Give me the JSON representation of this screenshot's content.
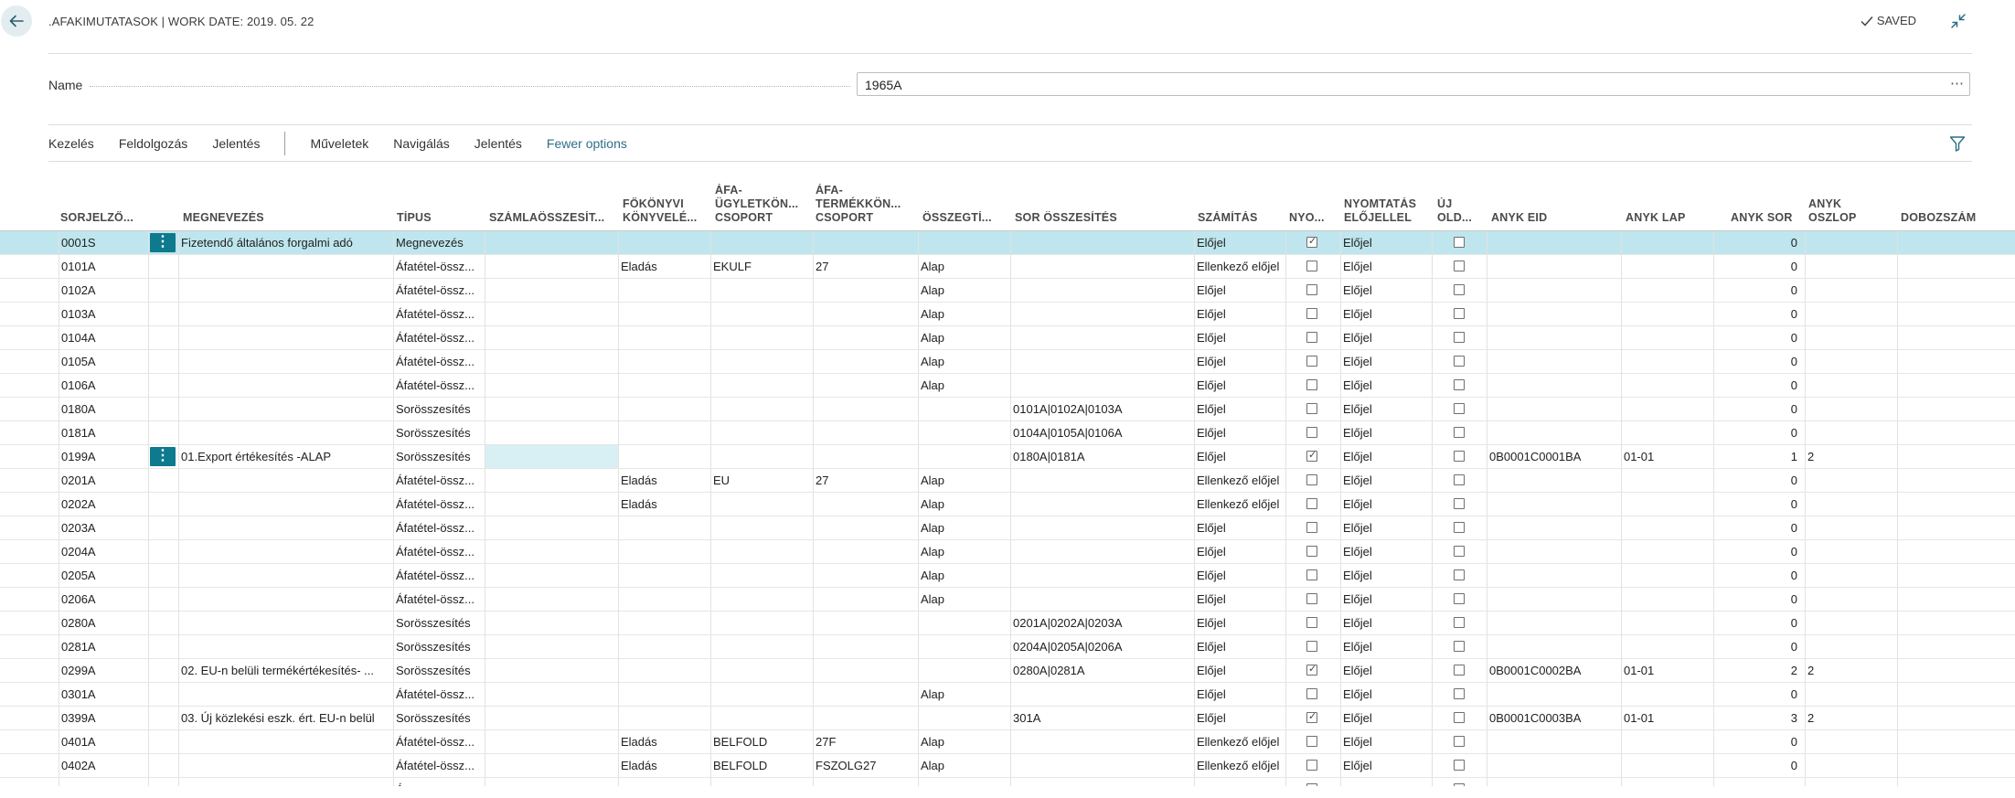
{
  "header": {
    "title": ".AFAKIMUTATASOK | WORK DATE: 2019. 05. 22",
    "saved_label": "SAVED"
  },
  "name_field": {
    "label": "Name",
    "value": "1965A"
  },
  "actions": {
    "items": [
      "Kezelés",
      "Feldolgozás",
      "Jelentés",
      "Műveletek",
      "Navigálás",
      "Jelentés"
    ],
    "fewer_options": "Fewer options"
  },
  "columns": [
    {
      "key": "sorjelzo",
      "l1": "",
      "l2": "SORJELZŐ..."
    },
    {
      "key": "megnevezes",
      "l1": "",
      "l2": "MEGNEVEZÉS"
    },
    {
      "key": "tipus",
      "l1": "",
      "l2": "TÍPUS"
    },
    {
      "key": "szamla",
      "l1": "",
      "l2": "SZÁMLAÖSSZESÍT..."
    },
    {
      "key": "fokonyv",
      "l1": "FŐKÖNYVI",
      "l2": "KÖNYVELÉ..."
    },
    {
      "key": "afa_ugylet",
      "l1": "ÁFA-",
      "l2": "ÜGYLETKÖN...",
      "l3": "CSOPORT"
    },
    {
      "key": "afa_termek",
      "l1": "ÁFA-",
      "l2": "TERMÉKKÖN...",
      "l3": "CSOPORT"
    },
    {
      "key": "osszegtip",
      "l1": "",
      "l2": "ÖSSZEGTÍ..."
    },
    {
      "key": "sor_ossz",
      "l1": "",
      "l2": "SOR ÖSSZESÍTÉS"
    },
    {
      "key": "szamitas",
      "l1": "",
      "l2": "SZÁMÍTÁS"
    },
    {
      "key": "nyo",
      "l1": "",
      "l2": "NYO..."
    },
    {
      "key": "nyomtatas",
      "l1": "NYOMTATÁS",
      "l2": "ELŐJELLEL"
    },
    {
      "key": "uj_old",
      "l1": "ÚJ",
      "l2": "OLD..."
    },
    {
      "key": "anyk_eid",
      "l1": "",
      "l2": "ANYK EID"
    },
    {
      "key": "anyk_lap",
      "l1": "",
      "l2": "ANYK LAP"
    },
    {
      "key": "anyk_sor",
      "l1": "",
      "l2": "ANYK SOR"
    },
    {
      "key": "anyk_oszlop",
      "l1": "ANYK",
      "l2": "OSZLOP"
    },
    {
      "key": "dobozszam",
      "l1": "",
      "l2": "DOBOZSZÁM"
    }
  ],
  "rows": [
    {
      "sorjelzo": "0001S",
      "megnevezes": "Fizetendő általános forgalmi adó",
      "tipus": "Megnevezés",
      "szamla": "",
      "fokonyv": "",
      "afa_ugylet": "",
      "afa_termek": "",
      "osszegtip": "",
      "sor_ossz": "",
      "szamitas": "Előjel",
      "nyo": true,
      "nyomtatas": "Előjel",
      "uj_old": false,
      "anyk_eid": "",
      "anyk_lap": "",
      "anyk_sor": "0",
      "anyk_oszlop": "",
      "dobozszam": "",
      "selected": true
    },
    {
      "sorjelzo": "0101A",
      "megnevezes": "",
      "tipus": "Áfatétel-össz...",
      "szamla": "",
      "fokonyv": "Eladás",
      "afa_ugylet": "EKULF",
      "afa_termek": "27",
      "osszegtip": "Alap",
      "sor_ossz": "",
      "szamitas": "Ellenkező előjel",
      "nyo": false,
      "nyomtatas": "Előjel",
      "uj_old": false,
      "anyk_eid": "",
      "anyk_lap": "",
      "anyk_sor": "0",
      "anyk_oszlop": "",
      "dobozszam": ""
    },
    {
      "sorjelzo": "0102A",
      "megnevezes": "",
      "tipus": "Áfatétel-össz...",
      "szamla": "",
      "fokonyv": "",
      "afa_ugylet": "",
      "afa_termek": "",
      "osszegtip": "Alap",
      "sor_ossz": "",
      "szamitas": "Előjel",
      "nyo": false,
      "nyomtatas": "Előjel",
      "uj_old": false,
      "anyk_eid": "",
      "anyk_lap": "",
      "anyk_sor": "0",
      "anyk_oszlop": "",
      "dobozszam": ""
    },
    {
      "sorjelzo": "0103A",
      "megnevezes": "",
      "tipus": "Áfatétel-össz...",
      "szamla": "",
      "fokonyv": "",
      "afa_ugylet": "",
      "afa_termek": "",
      "osszegtip": "Alap",
      "sor_ossz": "",
      "szamitas": "Előjel",
      "nyo": false,
      "nyomtatas": "Előjel",
      "uj_old": false,
      "anyk_eid": "",
      "anyk_lap": "",
      "anyk_sor": "0",
      "anyk_oszlop": "",
      "dobozszam": ""
    },
    {
      "sorjelzo": "0104A",
      "megnevezes": "",
      "tipus": "Áfatétel-össz...",
      "szamla": "",
      "fokonyv": "",
      "afa_ugylet": "",
      "afa_termek": "",
      "osszegtip": "Alap",
      "sor_ossz": "",
      "szamitas": "Előjel",
      "nyo": false,
      "nyomtatas": "Előjel",
      "uj_old": false,
      "anyk_eid": "",
      "anyk_lap": "",
      "anyk_sor": "0",
      "anyk_oszlop": "",
      "dobozszam": ""
    },
    {
      "sorjelzo": "0105A",
      "megnevezes": "",
      "tipus": "Áfatétel-össz...",
      "szamla": "",
      "fokonyv": "",
      "afa_ugylet": "",
      "afa_termek": "",
      "osszegtip": "Alap",
      "sor_ossz": "",
      "szamitas": "Előjel",
      "nyo": false,
      "nyomtatas": "Előjel",
      "uj_old": false,
      "anyk_eid": "",
      "anyk_lap": "",
      "anyk_sor": "0",
      "anyk_oszlop": "",
      "dobozszam": ""
    },
    {
      "sorjelzo": "0106A",
      "megnevezes": "",
      "tipus": "Áfatétel-össz...",
      "szamla": "",
      "fokonyv": "",
      "afa_ugylet": "",
      "afa_termek": "",
      "osszegtip": "Alap",
      "sor_ossz": "",
      "szamitas": "Előjel",
      "nyo": false,
      "nyomtatas": "Előjel",
      "uj_old": false,
      "anyk_eid": "",
      "anyk_lap": "",
      "anyk_sor": "0",
      "anyk_oszlop": "",
      "dobozszam": ""
    },
    {
      "sorjelzo": "0180A",
      "megnevezes": "",
      "tipus": "Sorösszesítés",
      "szamla": "",
      "fokonyv": "",
      "afa_ugylet": "",
      "afa_termek": "",
      "osszegtip": "",
      "sor_ossz": "0101A|0102A|0103A",
      "szamitas": "Előjel",
      "nyo": false,
      "nyomtatas": "Előjel",
      "uj_old": false,
      "anyk_eid": "",
      "anyk_lap": "",
      "anyk_sor": "0",
      "anyk_oszlop": "",
      "dobozszam": ""
    },
    {
      "sorjelzo": "0181A",
      "megnevezes": "",
      "tipus": "Sorösszesítés",
      "szamla": "",
      "fokonyv": "",
      "afa_ugylet": "",
      "afa_termek": "",
      "osszegtip": "",
      "sor_ossz": "0104A|0105A|0106A",
      "szamitas": "Előjel",
      "nyo": false,
      "nyomtatas": "Előjel",
      "uj_old": false,
      "anyk_eid": "",
      "anyk_lap": "",
      "anyk_sor": "0",
      "anyk_oszlop": "",
      "dobozszam": ""
    },
    {
      "sorjelzo": "0199A",
      "megnevezes": "01.Export értékesítés -ALAP",
      "tipus": "Sorösszesítés",
      "szamla": "",
      "fokonyv": "",
      "afa_ugylet": "",
      "afa_termek": "",
      "osszegtip": "",
      "sor_ossz": "0180A|0181A",
      "szamitas": "Előjel",
      "nyo": true,
      "nyomtatas": "Előjel",
      "uj_old": false,
      "anyk_eid": "0B0001C0001BA",
      "anyk_lap": "01-01",
      "anyk_sor": "1",
      "anyk_oszlop": "2",
      "dobozszam": "",
      "focus": true
    },
    {
      "sorjelzo": "0201A",
      "megnevezes": "",
      "tipus": "Áfatétel-össz...",
      "szamla": "",
      "fokonyv": "Eladás",
      "afa_ugylet": "EU",
      "afa_termek": "27",
      "osszegtip": "Alap",
      "sor_ossz": "",
      "szamitas": "Ellenkező előjel",
      "nyo": false,
      "nyomtatas": "Előjel",
      "uj_old": false,
      "anyk_eid": "",
      "anyk_lap": "",
      "anyk_sor": "0",
      "anyk_oszlop": "",
      "dobozszam": ""
    },
    {
      "sorjelzo": "0202A",
      "megnevezes": "",
      "tipus": "Áfatétel-össz...",
      "szamla": "",
      "fokonyv": "Eladás",
      "afa_ugylet": "",
      "afa_termek": "",
      "osszegtip": "Alap",
      "sor_ossz": "",
      "szamitas": "Ellenkező előjel",
      "nyo": false,
      "nyomtatas": "Előjel",
      "uj_old": false,
      "anyk_eid": "",
      "anyk_lap": "",
      "anyk_sor": "0",
      "anyk_oszlop": "",
      "dobozszam": ""
    },
    {
      "sorjelzo": "0203A",
      "megnevezes": "",
      "tipus": "Áfatétel-össz...",
      "szamla": "",
      "fokonyv": "",
      "afa_ugylet": "",
      "afa_termek": "",
      "osszegtip": "Alap",
      "sor_ossz": "",
      "szamitas": "Előjel",
      "nyo": false,
      "nyomtatas": "Előjel",
      "uj_old": false,
      "anyk_eid": "",
      "anyk_lap": "",
      "anyk_sor": "0",
      "anyk_oszlop": "",
      "dobozszam": ""
    },
    {
      "sorjelzo": "0204A",
      "megnevezes": "",
      "tipus": "Áfatétel-össz...",
      "szamla": "",
      "fokonyv": "",
      "afa_ugylet": "",
      "afa_termek": "",
      "osszegtip": "Alap",
      "sor_ossz": "",
      "szamitas": "Előjel",
      "nyo": false,
      "nyomtatas": "Előjel",
      "uj_old": false,
      "anyk_eid": "",
      "anyk_lap": "",
      "anyk_sor": "0",
      "anyk_oszlop": "",
      "dobozszam": ""
    },
    {
      "sorjelzo": "0205A",
      "megnevezes": "",
      "tipus": "Áfatétel-össz...",
      "szamla": "",
      "fokonyv": "",
      "afa_ugylet": "",
      "afa_termek": "",
      "osszegtip": "Alap",
      "sor_ossz": "",
      "szamitas": "Előjel",
      "nyo": false,
      "nyomtatas": "Előjel",
      "uj_old": false,
      "anyk_eid": "",
      "anyk_lap": "",
      "anyk_sor": "0",
      "anyk_oszlop": "",
      "dobozszam": ""
    },
    {
      "sorjelzo": "0206A",
      "megnevezes": "",
      "tipus": "Áfatétel-össz...",
      "szamla": "",
      "fokonyv": "",
      "afa_ugylet": "",
      "afa_termek": "",
      "osszegtip": "Alap",
      "sor_ossz": "",
      "szamitas": "Előjel",
      "nyo": false,
      "nyomtatas": "Előjel",
      "uj_old": false,
      "anyk_eid": "",
      "anyk_lap": "",
      "anyk_sor": "0",
      "anyk_oszlop": "",
      "dobozszam": ""
    },
    {
      "sorjelzo": "0280A",
      "megnevezes": "",
      "tipus": "Sorösszesítés",
      "szamla": "",
      "fokonyv": "",
      "afa_ugylet": "",
      "afa_termek": "",
      "osszegtip": "",
      "sor_ossz": "0201A|0202A|0203A",
      "szamitas": "Előjel",
      "nyo": false,
      "nyomtatas": "Előjel",
      "uj_old": false,
      "anyk_eid": "",
      "anyk_lap": "",
      "anyk_sor": "0",
      "anyk_oszlop": "",
      "dobozszam": ""
    },
    {
      "sorjelzo": "0281A",
      "megnevezes": "",
      "tipus": "Sorösszesítés",
      "szamla": "",
      "fokonyv": "",
      "afa_ugylet": "",
      "afa_termek": "",
      "osszegtip": "",
      "sor_ossz": "0204A|0205A|0206A",
      "szamitas": "Előjel",
      "nyo": false,
      "nyomtatas": "Előjel",
      "uj_old": false,
      "anyk_eid": "",
      "anyk_lap": "",
      "anyk_sor": "0",
      "anyk_oszlop": "",
      "dobozszam": ""
    },
    {
      "sorjelzo": "0299A",
      "megnevezes": "02. EU-n belüli termékértékesítés- ...",
      "tipus": "Sorösszesítés",
      "szamla": "",
      "fokonyv": "",
      "afa_ugylet": "",
      "afa_termek": "",
      "osszegtip": "",
      "sor_ossz": "0280A|0281A",
      "szamitas": "Előjel",
      "nyo": true,
      "nyomtatas": "Előjel",
      "uj_old": false,
      "anyk_eid": "0B0001C0002BA",
      "anyk_lap": "01-01",
      "anyk_sor": "2",
      "anyk_oszlop": "2",
      "dobozszam": ""
    },
    {
      "sorjelzo": "0301A",
      "megnevezes": "",
      "tipus": "Áfatétel-össz...",
      "szamla": "",
      "fokonyv": "",
      "afa_ugylet": "",
      "afa_termek": "",
      "osszegtip": "Alap",
      "sor_ossz": "",
      "szamitas": "Előjel",
      "nyo": false,
      "nyomtatas": "Előjel",
      "uj_old": false,
      "anyk_eid": "",
      "anyk_lap": "",
      "anyk_sor": "0",
      "anyk_oszlop": "",
      "dobozszam": ""
    },
    {
      "sorjelzo": "0399A",
      "megnevezes": "03. Új közlekési eszk. ért. EU-n belül",
      "tipus": "Sorösszesítés",
      "szamla": "",
      "fokonyv": "",
      "afa_ugylet": "",
      "afa_termek": "",
      "osszegtip": "",
      "sor_ossz": "301A",
      "szamitas": "Előjel",
      "nyo": true,
      "nyomtatas": "Előjel",
      "uj_old": false,
      "anyk_eid": "0B0001C0003BA",
      "anyk_lap": "01-01",
      "anyk_sor": "3",
      "anyk_oszlop": "2",
      "dobozszam": ""
    },
    {
      "sorjelzo": "0401A",
      "megnevezes": "",
      "tipus": "Áfatétel-össz...",
      "szamla": "",
      "fokonyv": "Eladás",
      "afa_ugylet": "BELFOLD",
      "afa_termek": "27F",
      "osszegtip": "Alap",
      "sor_ossz": "",
      "szamitas": "Ellenkező előjel",
      "nyo": false,
      "nyomtatas": "Előjel",
      "uj_old": false,
      "anyk_eid": "",
      "anyk_lap": "",
      "anyk_sor": "0",
      "anyk_oszlop": "",
      "dobozszam": ""
    },
    {
      "sorjelzo": "0402A",
      "megnevezes": "",
      "tipus": "Áfatétel-össz...",
      "szamla": "",
      "fokonyv": "Eladás",
      "afa_ugylet": "BELFOLD",
      "afa_termek": "FSZOLG27",
      "osszegtip": "Alap",
      "sor_ossz": "",
      "szamitas": "Ellenkező előjel",
      "nyo": false,
      "nyomtatas": "Előjel",
      "uj_old": false,
      "anyk_eid": "",
      "anyk_lap": "",
      "anyk_sor": "0",
      "anyk_oszlop": "",
      "dobozszam": ""
    },
    {
      "sorjelzo": "",
      "megnevezes": "",
      "tipus": "Á",
      "szamla": "",
      "fokonyv": "",
      "afa_ugylet": "",
      "afa_termek": "",
      "osszegtip": "",
      "sor_ossz": "",
      "szamitas": "",
      "nyo": false,
      "nyomtatas": "",
      "uj_old": false,
      "anyk_eid": "",
      "anyk_lap": "",
      "anyk_sor": "",
      "anyk_oszlop": "",
      "dobozszam": ""
    }
  ],
  "colors": {
    "accent": "#0e7a8e",
    "selected_row": "#bfe6ee",
    "focus_cell": "#d8eff3",
    "link": "#2f6e8a"
  }
}
